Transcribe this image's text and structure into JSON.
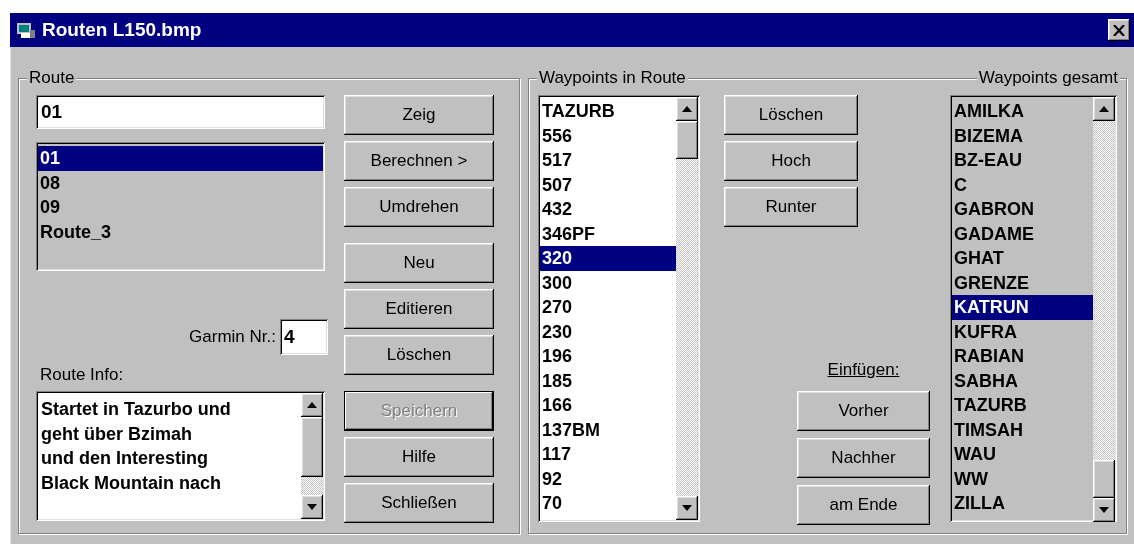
{
  "window": {
    "title": "Routen L150.bmp"
  },
  "route_group": {
    "legend": "Route",
    "name_field": {
      "value": "01"
    },
    "routes": [
      {
        "label": "01",
        "selected": true
      },
      {
        "label": "08",
        "selected": false
      },
      {
        "label": "09",
        "selected": false
      },
      {
        "label": "Route_3",
        "selected": false
      }
    ],
    "garmin": {
      "label": "Garmin Nr.:",
      "value": "4"
    },
    "info_label": "Route Info:",
    "info_text": "Startet in Tazurbo und\ngeht über Bzimah\nund den Interesting\nBlack Mountain nach",
    "buttons": [
      {
        "label": "Zeig",
        "disabled": false,
        "default": false
      },
      {
        "label": "Berechnen >",
        "disabled": false,
        "default": false
      },
      {
        "label": "Umdrehen",
        "disabled": false,
        "default": false
      },
      {
        "label": "Neu",
        "disabled": false,
        "default": false
      },
      {
        "label": "Editieren",
        "disabled": false,
        "default": false
      },
      {
        "label": "Löschen",
        "disabled": false,
        "default": false
      },
      {
        "label": "Speichern",
        "disabled": true,
        "default": true
      },
      {
        "label": "Hilfe",
        "disabled": false,
        "default": false
      },
      {
        "label": "Schließen",
        "disabled": false,
        "default": false
      }
    ]
  },
  "waypoint_group": {
    "legend_route": "Waypoints in Route",
    "legend_all": "Waypoints gesamt",
    "route_waypoints": [
      {
        "label": "TAZURB",
        "selected": false
      },
      {
        "label": "556",
        "selected": false
      },
      {
        "label": "517",
        "selected": false
      },
      {
        "label": "507",
        "selected": false
      },
      {
        "label": "432",
        "selected": false
      },
      {
        "label": "346PF",
        "selected": false
      },
      {
        "label": "320",
        "selected": true
      },
      {
        "label": "300",
        "selected": false
      },
      {
        "label": "270",
        "selected": false
      },
      {
        "label": "230",
        "selected": false
      },
      {
        "label": "196",
        "selected": false
      },
      {
        "label": "185",
        "selected": false
      },
      {
        "label": "166",
        "selected": false
      },
      {
        "label": "137BM",
        "selected": false
      },
      {
        "label": "117",
        "selected": false
      },
      {
        "label": "92",
        "selected": false
      },
      {
        "label": "70",
        "selected": false
      }
    ],
    "edit_buttons": [
      {
        "label": "Löschen",
        "disabled": false
      },
      {
        "label": "Hoch",
        "disabled": false
      },
      {
        "label": "Runter",
        "disabled": false
      }
    ],
    "insert_label": "Einfügen:",
    "insert_buttons": [
      {
        "label": "Vorher",
        "disabled": false
      },
      {
        "label": "Nachher",
        "disabled": false
      },
      {
        "label": "am Ende",
        "disabled": false
      }
    ],
    "all_waypoints": [
      {
        "label": "AMILKA",
        "selected": false
      },
      {
        "label": "BIZEMA",
        "selected": false
      },
      {
        "label": "BZ-EAU",
        "selected": false
      },
      {
        "label": "C",
        "selected": false
      },
      {
        "label": "GABRON",
        "selected": false
      },
      {
        "label": "GADAME",
        "selected": false
      },
      {
        "label": "GHAT",
        "selected": false
      },
      {
        "label": "GRENZE",
        "selected": false
      },
      {
        "label": "KATRUN",
        "selected": true
      },
      {
        "label": "KUFRA",
        "selected": false
      },
      {
        "label": "RABIAN",
        "selected": false
      },
      {
        "label": "SABHA",
        "selected": false
      },
      {
        "label": "TAZURB",
        "selected": false
      },
      {
        "label": "TIMSAH",
        "selected": false
      },
      {
        "label": "WAU",
        "selected": false
      },
      {
        "label": "WW",
        "selected": false
      },
      {
        "label": "ZILLA",
        "selected": false
      }
    ]
  }
}
